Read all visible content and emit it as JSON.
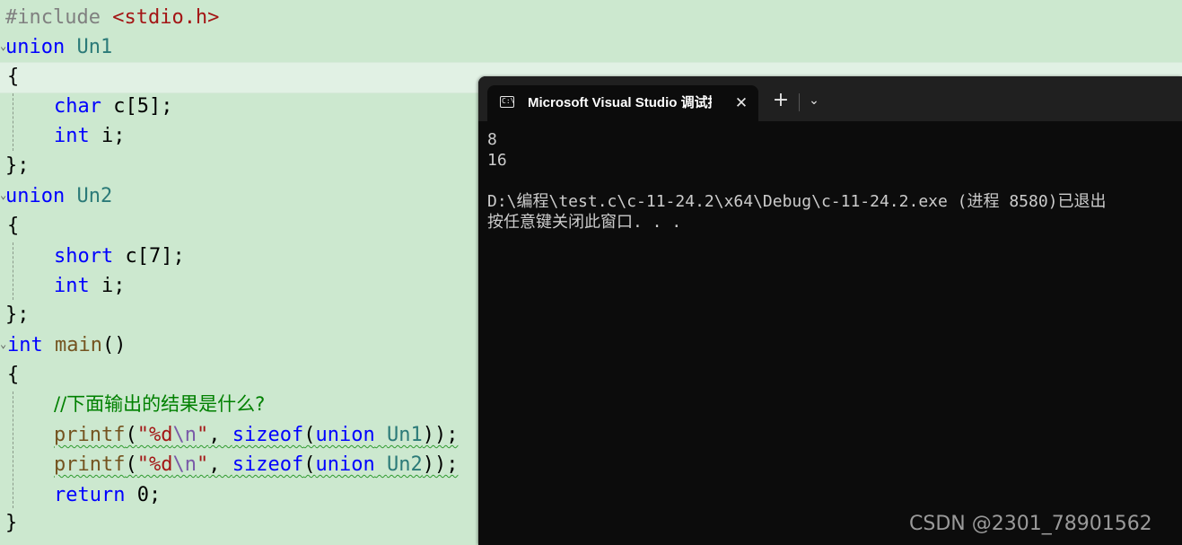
{
  "editor": {
    "include": {
      "directive": "#include",
      "header": "<stdio.h>"
    },
    "union1": {
      "keyword": "union",
      "name": "Un1",
      "open": "{",
      "member1_type": "char",
      "member1_rest": " c[5];",
      "member2_type": "int",
      "member2_rest": " i;",
      "close": "};"
    },
    "union2": {
      "keyword": "union",
      "name": "Un2",
      "open": "{",
      "member1_type": "short",
      "member1_rest": " c[7];",
      "member2_type": "int",
      "member2_rest": " i;",
      "close": "};"
    },
    "main": {
      "ret_type": "int",
      "name": "main",
      "parens": "()",
      "open": "{",
      "comment": "//下面输出的结果是什么?",
      "printf1": {
        "fn": "printf",
        "p1": "(",
        "q1": "\"%d",
        "esc": "\\n",
        "q2": "\"",
        "comma": ", ",
        "sizeof": "sizeof",
        "p2": "(",
        "kw": "union",
        "sp": " ",
        "type": "Un1",
        "end": "));"
      },
      "printf2": {
        "fn": "printf",
        "p1": "(",
        "q1": "\"%d",
        "esc": "\\n",
        "q2": "\"",
        "comma": ", ",
        "sizeof": "sizeof",
        "p2": "(",
        "kw": "union",
        "sp": " ",
        "type": "Un2",
        "end": "));"
      },
      "return_kw": "return",
      "return_rest": " 0;",
      "close": "}"
    }
  },
  "terminal": {
    "tab_title": "Microsoft Visual Studio 调试控",
    "tab_icon_text": "C:\\",
    "close_symbol": "✕",
    "new_tab_symbol": "+",
    "dropdown_symbol": "⌄",
    "lines": [
      "8",
      "16",
      "",
      "D:\\编程\\test.c\\c-11-24.2\\x64\\Debug\\c-11-24.2.exe (进程 8580)已退出",
      "按任意键关闭此窗口. . ."
    ]
  },
  "watermark": "CSDN @2301_78901562"
}
